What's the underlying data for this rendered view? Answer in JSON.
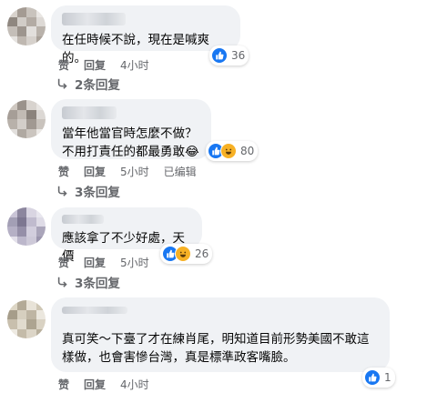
{
  "comments": [
    {
      "text": "在任時候不說，現在是喊爽的。",
      "reaction_count": "36",
      "reactions": [
        "like-icon"
      ],
      "actions": {
        "like": "赞",
        "reply": "回复",
        "time": "4小时"
      },
      "replies_label": "2条回复"
    },
    {
      "text": "當年他當官時怎麼不做？\n不用打責任的都最勇敢😂",
      "reaction_count": "80",
      "reactions": [
        "like-icon",
        "haha-icon"
      ],
      "actions": {
        "like": "赞",
        "reply": "回复",
        "time": "5小时",
        "edited": "已编辑"
      },
      "replies_label": "3条回复"
    },
    {
      "text": "應該拿了不少好處，天價",
      "reaction_count": "26",
      "reactions": [
        "like-icon",
        "haha-icon"
      ],
      "actions": {
        "like": "赞",
        "reply": "回复",
        "time": "5小时"
      },
      "replies_label": "3条回复"
    },
    {
      "text": "真可笑～下臺了才在練肖尾，明知道目前形勢美國不敢這\n樣做，也會害慘台灣，真是標準政客嘴臉。",
      "reaction_count": "1",
      "reactions": [
        "like-icon"
      ],
      "actions": {
        "like": "赞",
        "reply": "回复",
        "time": "4小时"
      }
    }
  ],
  "colors": {
    "like_blue": "#1877f2",
    "haha_yellow": "#f7b125",
    "bubble_bg": "#f0f2f5",
    "meta_gray": "#65676b"
  }
}
